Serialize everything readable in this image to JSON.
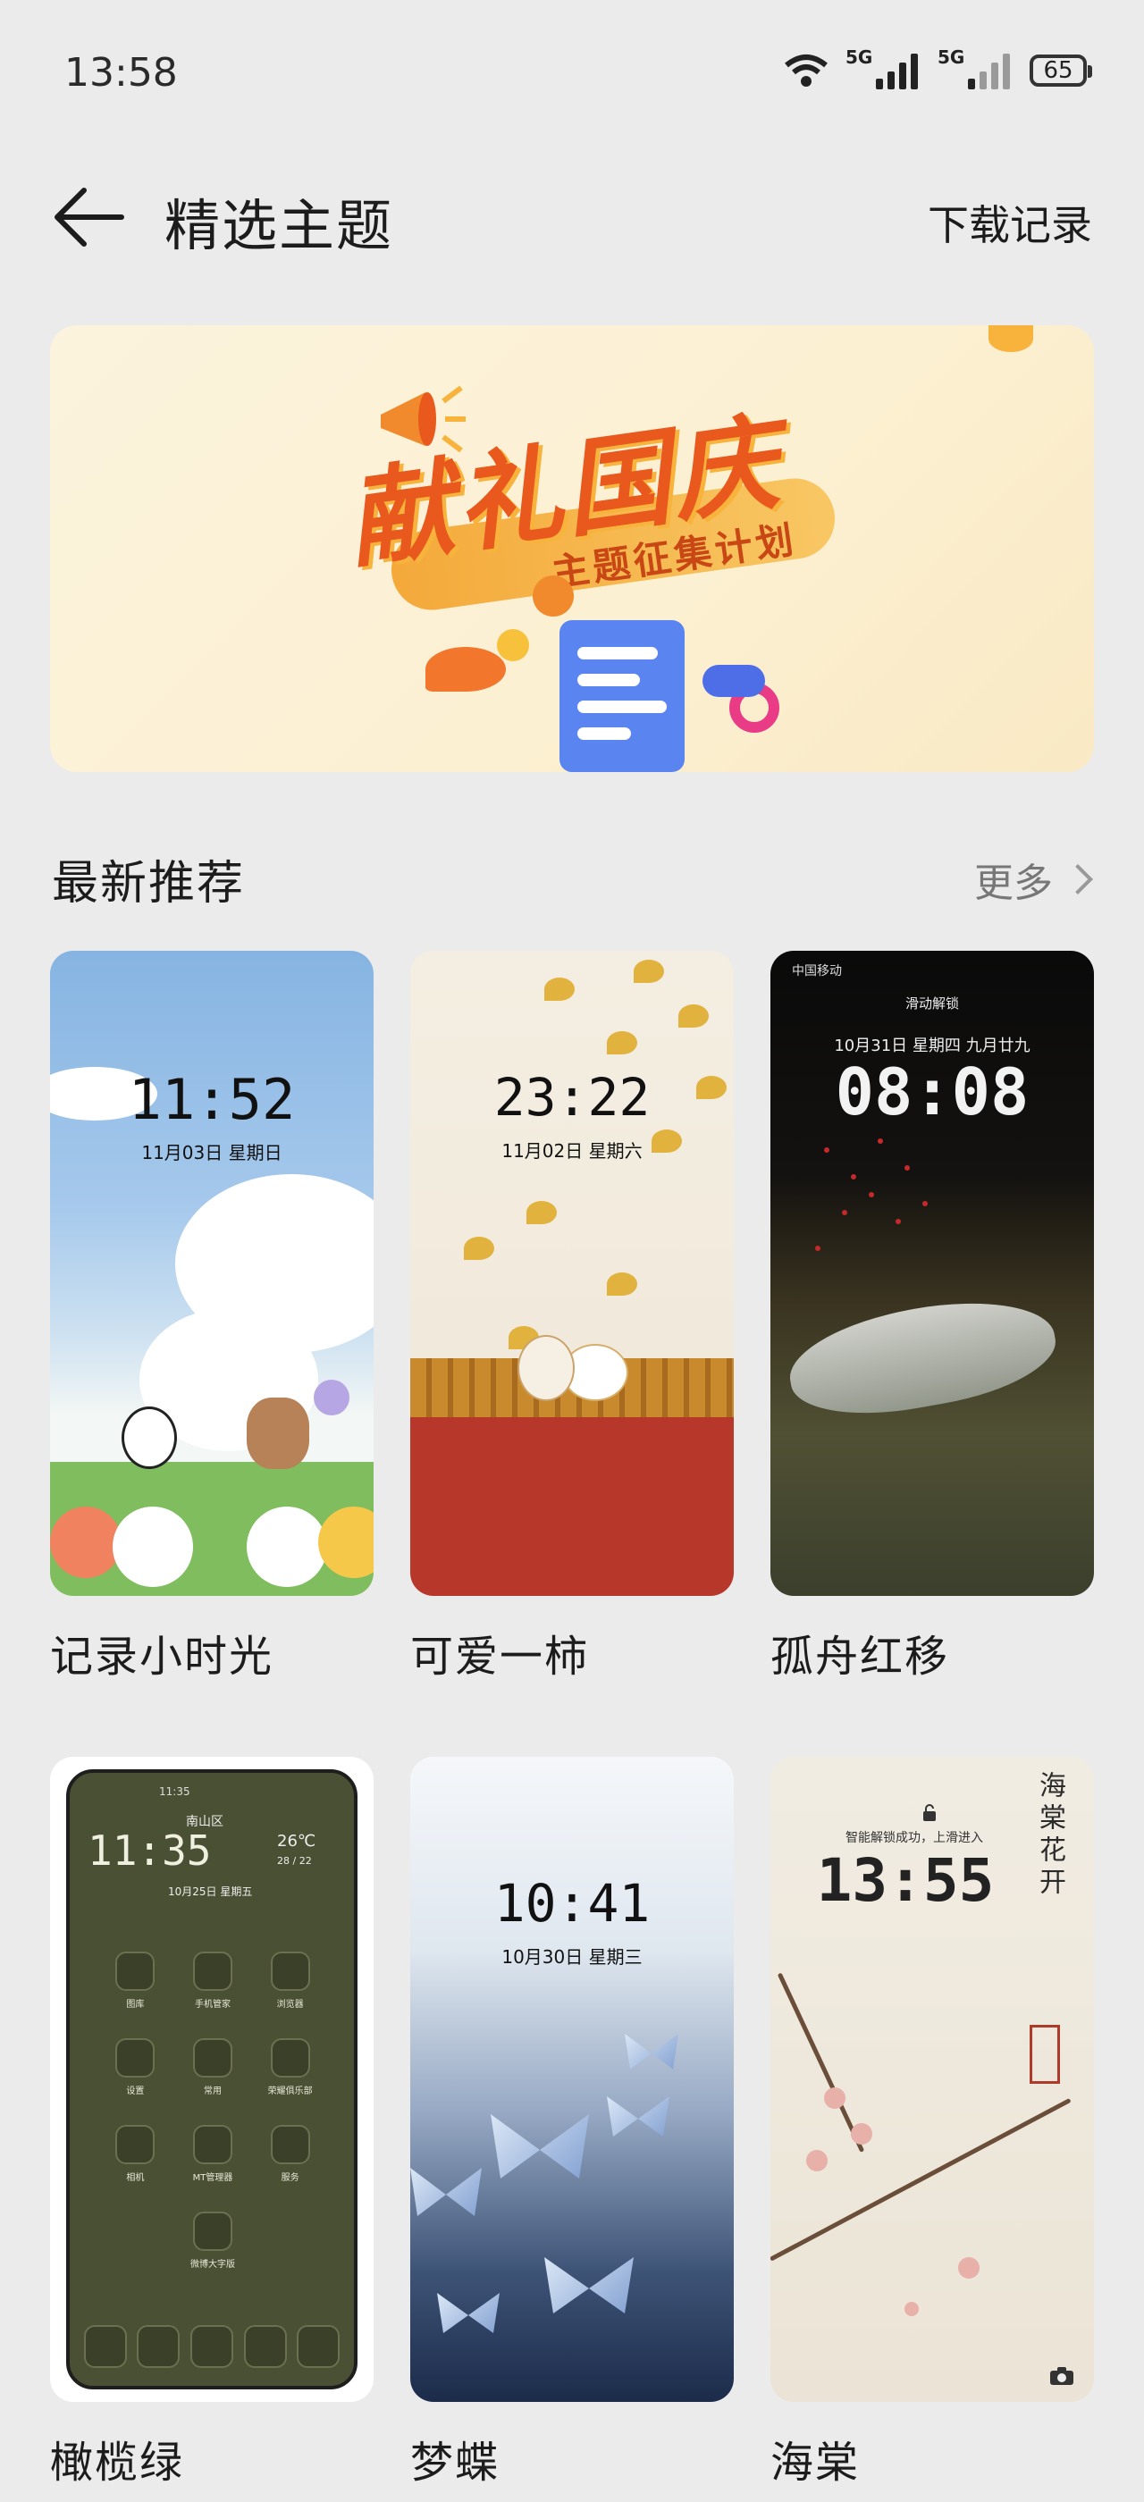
{
  "status_bar": {
    "time": "13:58",
    "sig1": "5G",
    "sig2": "5G",
    "battery": "65"
  },
  "header": {
    "title": "精选主题",
    "download": "下载记录"
  },
  "banner": {
    "title": "献礼国庆",
    "subtitle": "主题征集计划"
  },
  "section": {
    "title": "最新推荐",
    "more": "更多"
  },
  "themes": [
    {
      "name": "记录小时光",
      "clock": "11:52",
      "date": "11月03日 星期日"
    },
    {
      "name": "可爱一柿",
      "clock": "23:22",
      "date": "11月02日 星期六"
    },
    {
      "name": "孤舟红移",
      "clock": "08:08",
      "date": "10月31日 星期四 九月廿九",
      "top": "中国移动",
      "unlock": "滑动解锁"
    },
    {
      "name": "橄榄绿",
      "clock": "11:35",
      "date": "10月25日 星期五",
      "place": "南山区",
      "weather": "26℃",
      "range": "28 / 22",
      "mini_time": "11:35",
      "apps": [
        "图库",
        "手机管家",
        "浏览器",
        "设置",
        "常用",
        "荣耀俱乐部",
        "相机",
        "MT管理器",
        "服务",
        "微博大字版"
      ]
    },
    {
      "name": "梦蝶",
      "clock": "10:41",
      "date": "10月30日 星期三"
    },
    {
      "name": "海棠",
      "clock": "13:55",
      "date": "智能解锁成功，上滑进入",
      "poem": "海棠花开"
    }
  ],
  "colors": {
    "background": "#ebebeb",
    "accent": "#e9581d"
  }
}
